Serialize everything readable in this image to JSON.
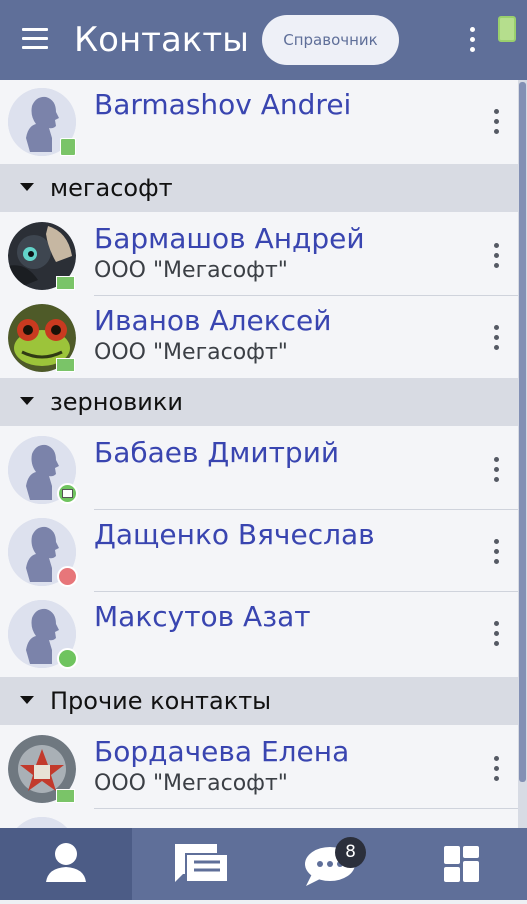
{
  "topbar": {
    "title": "Контакты",
    "directory_button": "Справочник"
  },
  "contacts": [
    {
      "name": "Barmashov Andrei",
      "company": ""
    }
  ],
  "sections": [
    {
      "label": "мегасофт",
      "contacts": [
        {
          "name": "Бармашов Андрей",
          "company": "ООО \"Мегасофт\""
        },
        {
          "name": "Иванов Алексей",
          "company": "ООО \"Мегасофт\""
        }
      ]
    },
    {
      "label": "зерновики",
      "contacts": [
        {
          "name": "Бабаев Дмитрий",
          "company": ""
        },
        {
          "name": "Дащенко Вячеслав",
          "company": ""
        },
        {
          "name": "Максутов Азат",
          "company": ""
        }
      ]
    },
    {
      "label": "Прочие контакты",
      "contacts": [
        {
          "name": "Бордачева Елена",
          "company": "ООО \"Мегасофт\""
        }
      ]
    }
  ],
  "bottom_nav": {
    "messages_badge": "8"
  },
  "colors": {
    "primary": "#5f6f99",
    "accent_text": "#3945b0",
    "section_bg": "#d8dbe3",
    "online": "#6fc45f",
    "busy": "#e7767a",
    "device": "#78c46a"
  }
}
